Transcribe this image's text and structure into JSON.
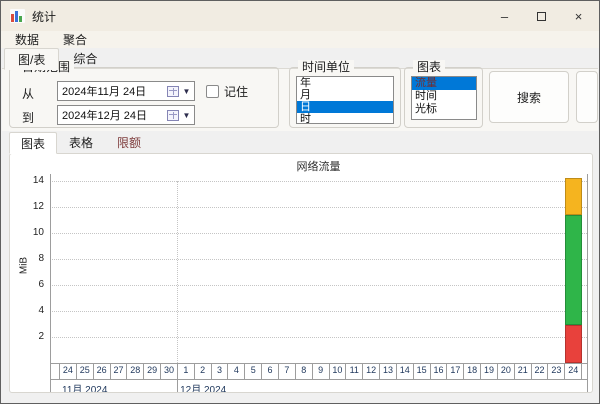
{
  "window": {
    "title": "统计",
    "icon": "bar-chart-icon",
    "controls": [
      {
        "name": "minimize-button",
        "glyph": "–"
      },
      {
        "name": "maximize-button",
        "glyph": "□"
      },
      {
        "name": "close-button",
        "glyph": "×"
      }
    ]
  },
  "menu": {
    "items": [
      {
        "name": "menu-data",
        "label": "数据"
      },
      {
        "name": "menu-aggregate",
        "label": "聚合"
      }
    ]
  },
  "upper_tabs": [
    {
      "name": "tab-chart-table",
      "label": "图/表",
      "selected": true
    },
    {
      "name": "tab-comprehensive",
      "label": "综合",
      "selected": false
    }
  ],
  "date_range": {
    "title": "日期范围",
    "from_label": "从",
    "from_value": "2024年11月 24日",
    "to_label": "到",
    "to_value": "2024年12月 24日",
    "remember_label": "记住",
    "remember_checked": false
  },
  "time_unit": {
    "title": "时间单位",
    "items": [
      "年",
      "月",
      "日",
      "时"
    ],
    "selected_index": 2
  },
  "chart_type": {
    "title": "图表",
    "items": [
      "流量",
      "时间",
      "光标"
    ],
    "selected_index": 0,
    "selected_text_color": "#732d2d"
  },
  "search_button_label": "搜索",
  "lower_tabs": [
    {
      "name": "tab-chart",
      "label": "图表",
      "selected": true,
      "color": "#1e1e1e"
    },
    {
      "name": "tab-table",
      "label": "表格",
      "selected": false,
      "color": "#1e1e1e"
    },
    {
      "name": "tab-quota",
      "label": "限额",
      "selected": false,
      "color": "#7d3b3b"
    }
  ],
  "colors": {
    "selection": "#0078d7",
    "bar_red": "#e8413c",
    "bar_green": "#2fb549",
    "bar_yellow": "#f5b41f"
  },
  "chart_data": {
    "type": "bar",
    "title": "网络流量",
    "ylabel": "MiB",
    "ylim": [
      0,
      14.2
    ],
    "yticks": [
      2,
      4,
      6,
      8,
      10,
      12,
      14
    ],
    "grid": "dotted horizontal gridlines at each ytick, dotted vertical line at month boundary",
    "day_labels": [
      "24",
      "25",
      "26",
      "27",
      "28",
      "29",
      "30",
      "1",
      "2",
      "3",
      "4",
      "5",
      "6",
      "7",
      "8",
      "9",
      "10",
      "11",
      "12",
      "13",
      "14",
      "15",
      "16",
      "17",
      "18",
      "19",
      "20",
      "21",
      "22",
      "23",
      "24"
    ],
    "month_labels": [
      {
        "label": "11月 2024",
        "start_day_index": 0
      },
      {
        "label": "12月 2024",
        "start_day_index": 7
      }
    ],
    "month_separator_index": 7,
    "bars": [
      {
        "day_index": 30,
        "date_label": "24",
        "segments": [
          {
            "name": "bottom-segment",
            "color": "#e8413c",
            "value": 2.9
          },
          {
            "name": "middle-segment",
            "color": "#2fb549",
            "value": 8.5
          },
          {
            "name": "top-segment",
            "color": "#f5b41f",
            "value": 2.8
          }
        ]
      }
    ]
  }
}
